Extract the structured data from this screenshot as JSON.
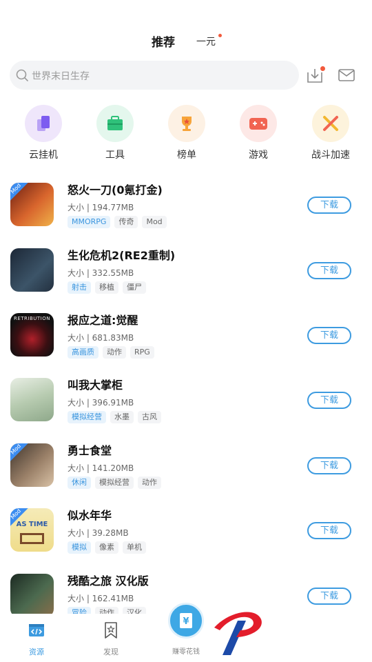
{
  "header": {
    "tab_main": "推荐",
    "tab_sub": "一元"
  },
  "search": {
    "placeholder": "世界末日生存"
  },
  "categories": [
    {
      "label": "云挂机",
      "icon": "cloud-phone-icon",
      "bg": "#efe6fb",
      "color": "#7d5cf0"
    },
    {
      "label": "工具",
      "icon": "toolbox-icon",
      "bg": "#e4f7ed",
      "color": "#2fc17a"
    },
    {
      "label": "榜单",
      "icon": "trophy-icon",
      "bg": "#fdf1e4",
      "color": "#f7a43a"
    },
    {
      "label": "游戏",
      "icon": "gamepad-icon",
      "bg": "#fde8e6",
      "color": "#f16452"
    },
    {
      "label": "战斗加速",
      "icon": "crossed-swords-icon",
      "bg": "#fdf3dc",
      "color": "#f2b730"
    }
  ],
  "games": [
    {
      "title": "怒火一刀(0氪打金)",
      "size": "大小 | 194.77MB",
      "tags": [
        "MMORPG",
        "传奇",
        "Mod"
      ],
      "mod": true,
      "thumb_bg": "#b2462a"
    },
    {
      "title": "生化危机2(RE2重制)",
      "size": "大小 | 332.55MB",
      "tags": [
        "射击",
        "移植",
        "僵尸"
      ],
      "mod": false,
      "thumb_bg": "#253040"
    },
    {
      "title": "报应之道:觉醒",
      "size": "大小 | 681.83MB",
      "tags": [
        "高画质",
        "动作",
        "RPG"
      ],
      "mod": false,
      "thumb_bg": "#161616",
      "thumb_text": "RETRIBUTION"
    },
    {
      "title": "叫我大掌柜",
      "size": "大小 | 396.91MB",
      "tags": [
        "模拟经营",
        "水墨",
        "古风"
      ],
      "mod": false,
      "thumb_bg": "#c9d9c6"
    },
    {
      "title": "勇士食堂",
      "size": "大小 | 141.20MB",
      "tags": [
        "休闲",
        "模拟经营",
        "动作"
      ],
      "mod": true,
      "thumb_bg": "#6c5a4c"
    },
    {
      "title": "似水年华",
      "size": "大小 | 39.28MB",
      "tags": [
        "模拟",
        "像素",
        "单机"
      ],
      "mod": true,
      "thumb_bg": "#f3e6a6",
      "thumb_text": "AS TIME"
    },
    {
      "title": "残酷之旅 汉化版",
      "size": "大小 | 162.41MB",
      "tags": [
        "冒险",
        "动作",
        "汉化"
      ],
      "mod": false,
      "thumb_bg": "#2a3b32"
    }
  ],
  "download_label": "下载",
  "bottom_nav": {
    "resources": "资源",
    "discover": "发现",
    "earn": "赚零花钱"
  },
  "colors": {
    "accent": "#3d9be0",
    "badge_dot": "#f25a3c"
  }
}
